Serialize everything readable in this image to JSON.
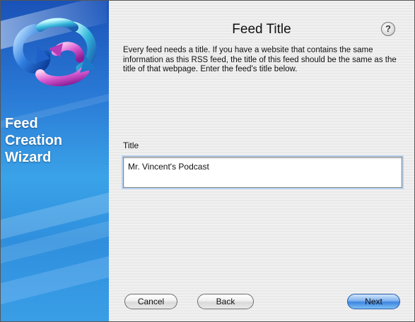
{
  "sidebar": {
    "title_lines": [
      "Feed",
      "Creation",
      "Wizard"
    ],
    "logo_icon": "feed-creation-logo-icon"
  },
  "main": {
    "title": "Feed Title",
    "help_label": "?",
    "description": "Every feed needs a title.  If you have a website that contains the same information as this RSS feed, the title of this feed should be the same as the title of that webpage.  Enter the feed's title below.",
    "field_label": "Title",
    "title_value": "Mr. Vincent's Podcast"
  },
  "buttons": {
    "cancel": "Cancel",
    "back": "Back",
    "next": "Next"
  },
  "colors": {
    "sidebar_blue": "#2a7ad6",
    "default_button": "#3e86e0"
  }
}
